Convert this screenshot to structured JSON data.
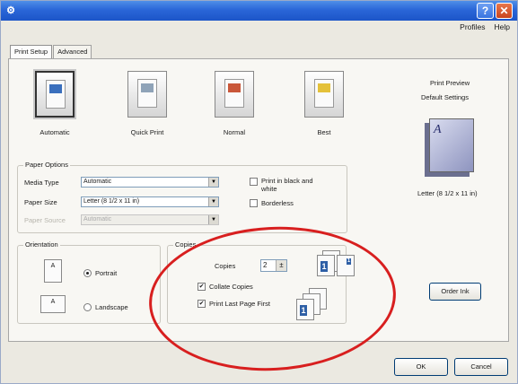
{
  "window": {
    "help_glyph": "?",
    "close_glyph": "✕",
    "app_glyph": "⚙"
  },
  "menu": {
    "items": [
      "Profiles",
      "Help"
    ]
  },
  "tabs": [
    {
      "label": "Print Setup",
      "active": true
    },
    {
      "label": "Advanced",
      "active": false
    }
  ],
  "modes": [
    {
      "label": "Automatic",
      "selected": true
    },
    {
      "label": "Quick Print",
      "selected": false
    },
    {
      "label": "Normal",
      "selected": false
    },
    {
      "label": "Best",
      "selected": false
    }
  ],
  "paper_options": {
    "group_label": "Paper Options",
    "media_type_label": "Media Type",
    "media_type_value": "Automatic",
    "paper_size_label": "Paper Size",
    "paper_size_value": "Letter (8 1/2 x 11 in)",
    "paper_source_label": "Paper Source",
    "paper_source_value": "Automatic",
    "black_white_label": "Print in black and white",
    "borderless_label": "Borderless"
  },
  "orientation": {
    "group_label": "Orientation",
    "portrait_label": "Portrait",
    "landscape_label": "Landscape",
    "page_glyph": "A"
  },
  "copies": {
    "group_label": "Copies",
    "copies_label": "Copies",
    "copies_value": "2",
    "collate_label": "Collate Copies",
    "last_page_first_label": "Print Last Page First",
    "collate_checked": true,
    "last_page_first_checked": true,
    "check_glyph": "✔",
    "stack_digit": "1"
  },
  "preview": {
    "title": "Print Preview",
    "subtitle": "Default Settings",
    "page_letter": "A",
    "size_label": "Letter (8 1/2 x 11 in)"
  },
  "buttons": {
    "order_ink": "Order Ink",
    "ok": "OK",
    "cancel": "Cancel"
  },
  "colors": {
    "title_bar": "#2a66d8",
    "annotation": "#d81f1f"
  }
}
